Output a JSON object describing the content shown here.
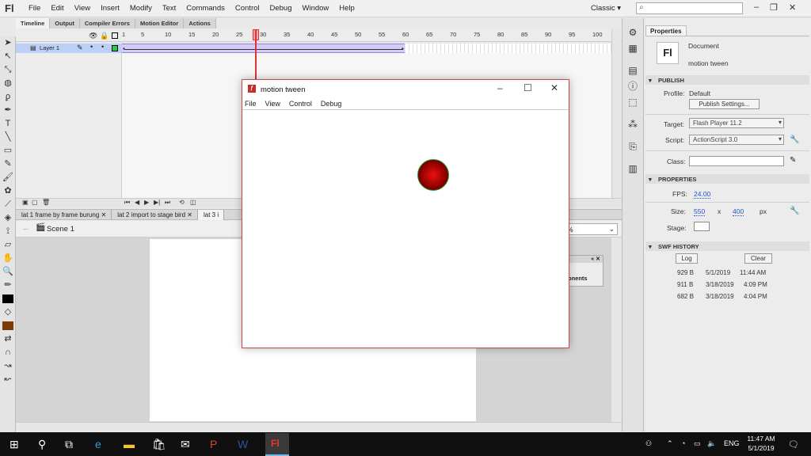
{
  "app": {
    "logo": "Fl",
    "menus": [
      "File",
      "Edit",
      "View",
      "Insert",
      "Modify",
      "Text",
      "Commands",
      "Control",
      "Debug",
      "Window",
      "Help"
    ],
    "workspace": "Classic",
    "search_placeholder": ""
  },
  "timeline": {
    "tabs": [
      "Timeline",
      "Output",
      "Compiler Errors",
      "Motion Editor",
      "Actions"
    ],
    "frame_numbers": [
      "1",
      "5",
      "10",
      "15",
      "20",
      "25",
      "30",
      "35",
      "40",
      "45",
      "50",
      "55",
      "60",
      "65",
      "70",
      "75",
      "80",
      "85",
      "90",
      "95",
      "100"
    ],
    "layer_name": "Layer 1",
    "current_frame": 28
  },
  "document_tabs": [
    "lat 1 frame by frame burung",
    "lat 2 import to stage bird",
    "lat 3 i"
  ],
  "scene": {
    "label": "Scene 1",
    "zoom": "%"
  },
  "components_panel": {
    "label": "onents"
  },
  "properties": {
    "tab": "Properties",
    "doc_type": "Document",
    "doc_name": "motion tween",
    "doc_icon": "Fl",
    "publish": {
      "header": "PUBLISH",
      "profile_label": "Profile:",
      "profile_value": "Default",
      "settings_button": "Publish Settings...",
      "target_label": "Target:",
      "target_value": "Flash Player 11.2",
      "script_label": "Script:",
      "script_value": "ActionScript 3.0",
      "class_label": "Class:"
    },
    "properties_section": {
      "header": "PROPERTIES",
      "fps_label": "FPS:",
      "fps_value": "24.00",
      "size_label": "Size:",
      "width": "550",
      "x": "x",
      "height": "400",
      "unit": "px",
      "stage_label": "Stage:",
      "stage_color": "#ffffff"
    },
    "swf_history": {
      "header": "SWF HISTORY",
      "log_button": "Log",
      "clear_button": "Clear",
      "rows": [
        {
          "size": "929 B",
          "date": "5/1/2019",
          "time": "11:44 AM"
        },
        {
          "size": "911 B",
          "date": "3/18/2019",
          "time": "4:09 PM"
        },
        {
          "size": "682 B",
          "date": "3/18/2019",
          "time": "4:04 PM"
        }
      ]
    }
  },
  "player": {
    "title": "motion tween",
    "menus": [
      "File",
      "View",
      "Control",
      "Debug"
    ],
    "ball_color": "#d81010"
  },
  "taskbar": {
    "lang": "ENG",
    "time": "11:47 AM",
    "date": "5/1/2019"
  }
}
